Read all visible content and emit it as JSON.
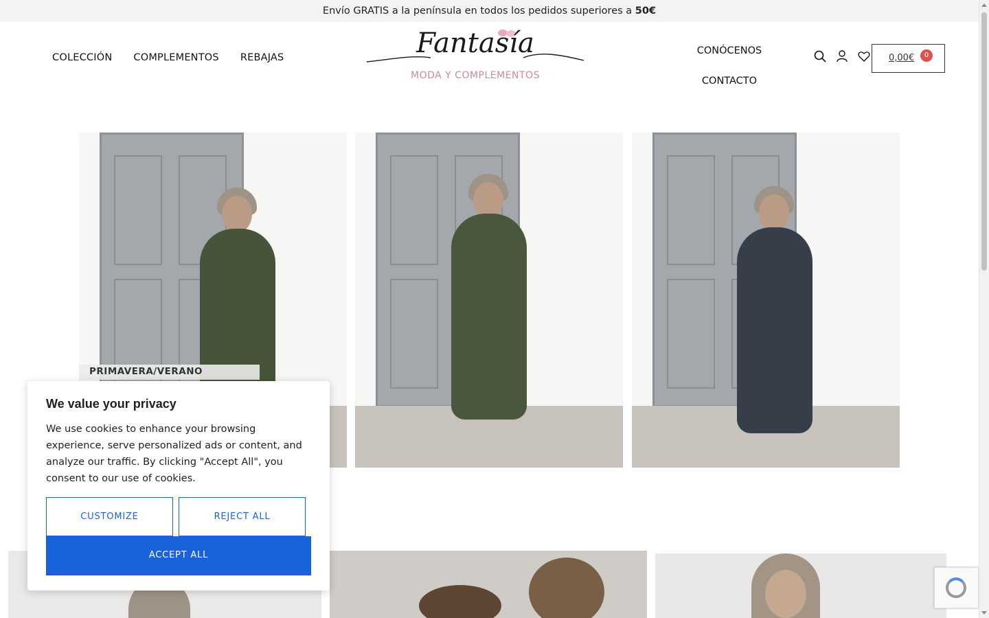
{
  "announcement": {
    "text": "Envío GRATIS a la península en todos los pedidos superiores a ",
    "highlight": "50€"
  },
  "nav": {
    "left": [
      "COLECCIÓN",
      "COMPLEMENTOS",
      "REBAJAS"
    ],
    "right": [
      "CONÓCENOS",
      "CONTACTO"
    ]
  },
  "logo": {
    "name": "Fantasía",
    "subtitle": "MODA Y COMPLEMENTOS"
  },
  "header_icons": [
    "search-icon",
    "user-icon",
    "heart-icon"
  ],
  "cart": {
    "total": "0,00€",
    "count": "0",
    "badge_color": "#d9534f"
  },
  "gallery": {
    "caption": "PRIMAVERA/VERANO"
  },
  "cookie_banner": {
    "title": "We value your privacy",
    "body": "We use cookies to enhance your browsing experience, serve personalized ads or content, and analyze our traffic. By clicking \"Accept All\", you consent to our use of cookies.",
    "customize_label": "CUSTOMIZE",
    "reject_label": "REJECT ALL",
    "accept_label": "ACCEPT ALL",
    "accent_color": "#1863dc"
  }
}
